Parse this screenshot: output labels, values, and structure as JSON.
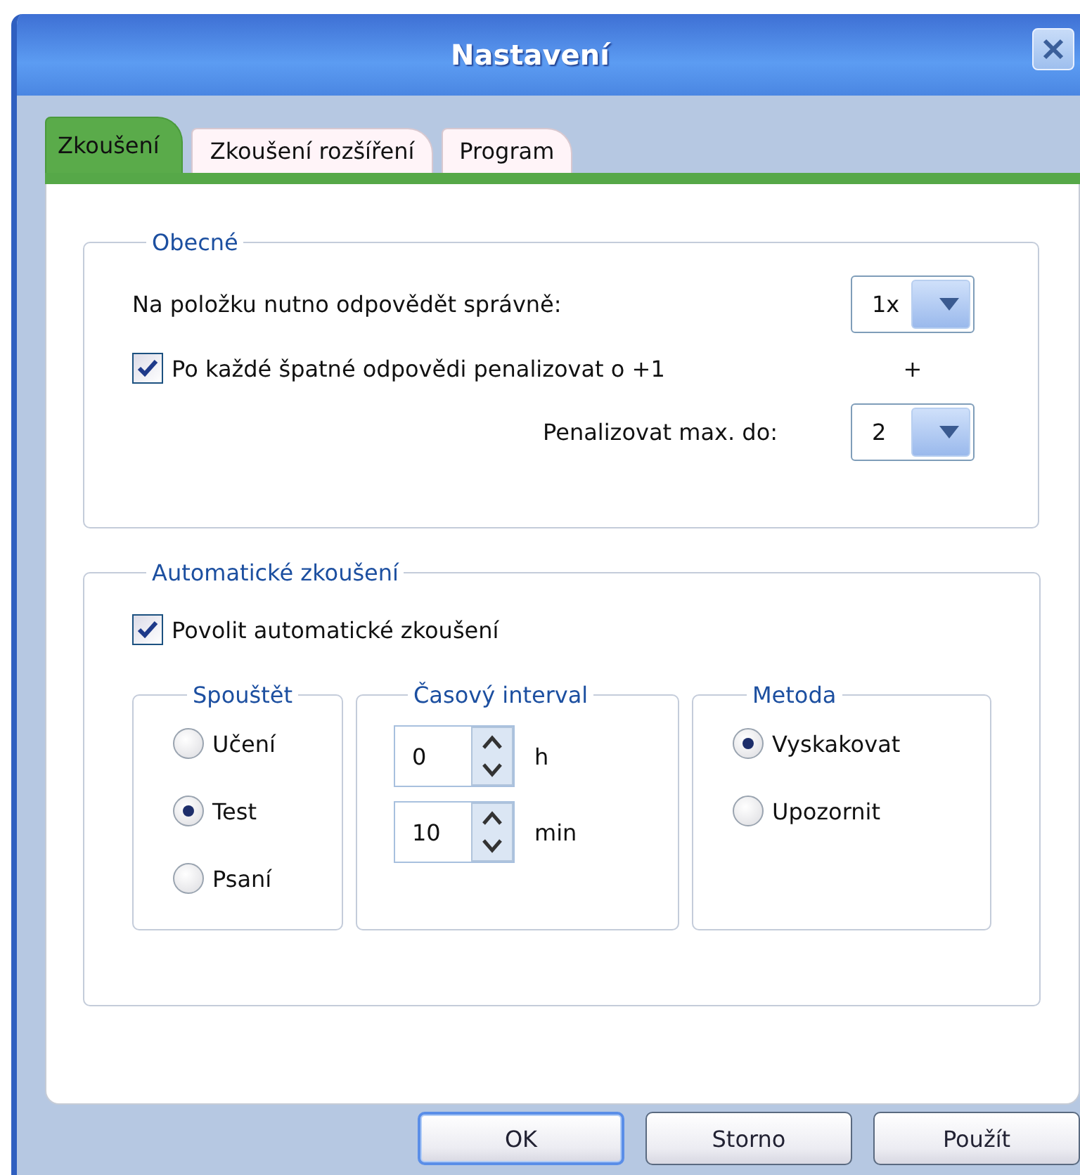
{
  "window": {
    "title": "Nastavení"
  },
  "tabs": [
    {
      "label": "Zkoušení",
      "selected": true
    },
    {
      "label": "Zkoušení rozšíření",
      "selected": false
    },
    {
      "label": "Program",
      "selected": false
    }
  ],
  "general": {
    "legend": "Obecné",
    "correct_label": "Na položku nutno odpovědět správně:",
    "correct_value": "1x",
    "penalize": {
      "label": "Po každé špatné odpovědi penalizovat o +1",
      "checked": true
    },
    "plus": "+",
    "max_label": "Penalizovat max. do:",
    "max_value": "2"
  },
  "automatic": {
    "legend": "Automatické zkoušení",
    "enable": {
      "label": "Povolit automatické zkoušení",
      "checked": true
    },
    "trigger": {
      "legend": "Spouštět",
      "options": [
        {
          "label": "Učení",
          "selected": false
        },
        {
          "label": "Test",
          "selected": true
        },
        {
          "label": "Psaní",
          "selected": false
        }
      ]
    },
    "interval": {
      "legend": "Časový interval",
      "fields": [
        {
          "value": "0",
          "unit": "h"
        },
        {
          "value": "10",
          "unit": "min"
        }
      ]
    },
    "method": {
      "legend": "Metoda",
      "options": [
        {
          "label": "Vyskakovat",
          "selected": true
        },
        {
          "label": "Upozornit",
          "selected": false
        }
      ]
    }
  },
  "buttons": [
    {
      "label": "OK",
      "default": true
    },
    {
      "label": "Storno",
      "default": false
    },
    {
      "label": "Použít",
      "default": false
    }
  ]
}
